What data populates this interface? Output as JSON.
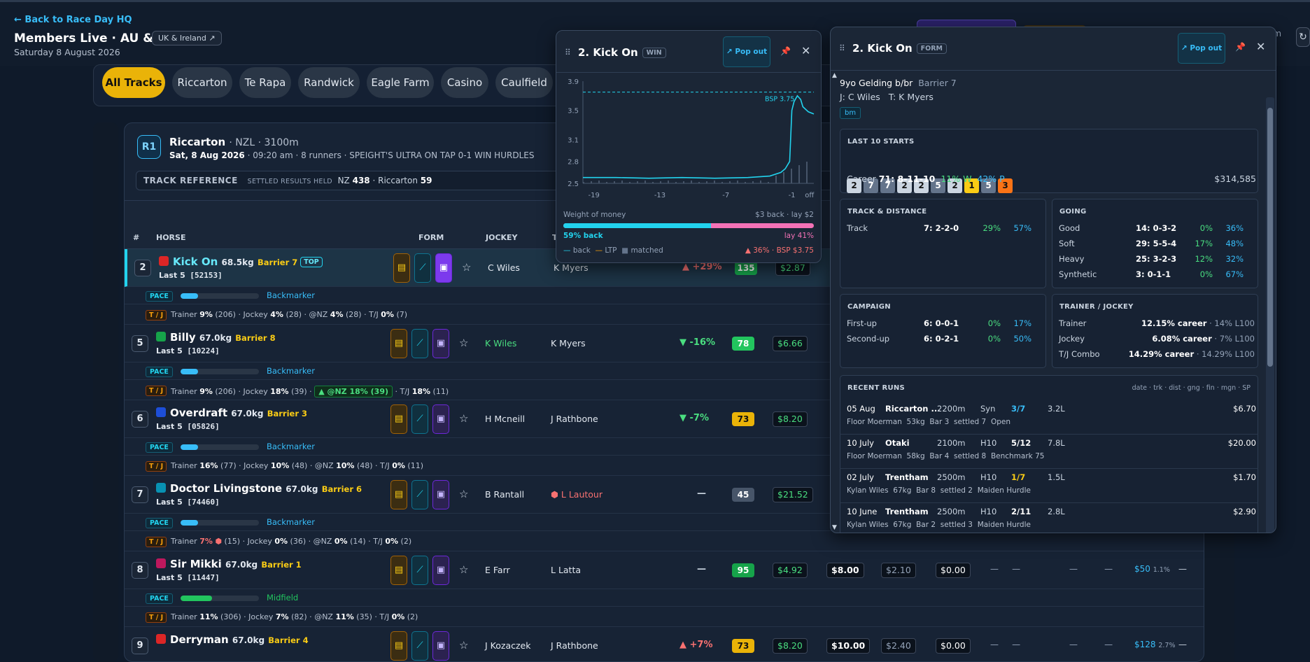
{
  "header": {
    "back": "← Back to Race Day HQ",
    "title": "Members Live · AU & NZ",
    "region": "UK & Ireland ↗",
    "date": "Saturday 8 August 2026",
    "right_text": "am",
    "right_icon": "refresh-icon"
  },
  "tracks": [
    "All Tracks",
    "Riccarton",
    "Te Rapa",
    "Randwick",
    "Eagle Farm",
    "Casino",
    "Caulfield"
  ],
  "race": {
    "badge": "R1",
    "track": "Riccarton",
    "meta": "· NZL · 3100m",
    "date": "Sat, 8 Aug 2026",
    "details": "· 09:20 am · 8 runners · SPEIGHT'S ULTRA ON TAP 0-1 WIN HURDLES",
    "ref_label": "TRACK REFERENCE",
    "ref_sub": "SETTLED RESULTS HELD",
    "ref_nz": "NZ",
    "ref_nz_val": "438",
    "ref_track": "· Riccarton",
    "ref_track_val": "59"
  },
  "columns": {
    "num": "#",
    "horse": "HORSE",
    "form": "FORM",
    "jockey": "JOCKEY",
    "trainer": "T"
  },
  "runners": [
    {
      "num": "2",
      "name": "Kick On",
      "weight": "68.5kg",
      "barrier": "Barrier 7",
      "top": "TOP",
      "last5": "Last 5",
      "form": "[52153]",
      "jockey": "C Wiles",
      "trainer": "K Myers",
      "move": "▲ +29%",
      "rating": "135",
      "odds": "$2.87",
      "pace": "Backmarker",
      "pace_pct": 0.22,
      "tj_trainer": "9%",
      "tj_tn": "(206)",
      "tj_jockey": "4%",
      "tj_jn": "(28)",
      "tj_nz": "4%",
      "tj_nzn": "(28)",
      "tj_combo": "0%",
      "tj_cn": "(7)",
      "silk": "#dc2626"
    },
    {
      "num": "5",
      "name": "Billy",
      "weight": "67.0kg",
      "barrier": "Barrier 8",
      "last5": "Last 5",
      "form": "[10224]",
      "jockey": "K Wiles",
      "trainer": "K Myers",
      "move": "▼ -16%",
      "rating": "78",
      "odds": "$6.66",
      "pace": "Backmarker",
      "pace_pct": 0.22,
      "tj_trainer": "9%",
      "tj_tn": "(206)",
      "tj_jockey": "18%",
      "tj_jn": "(39)",
      "tj_nzbadge": "▲ @NZ 18% (39)",
      "tj_combo": "18%",
      "tj_cn": "(11)",
      "silk": "#16a34a"
    },
    {
      "num": "6",
      "name": "Overdraft",
      "weight": "67.0kg",
      "barrier": "Barrier 3",
      "last5": "Last 5",
      "form": "[05826]",
      "jockey": "H Mcneill",
      "trainer": "J Rathbone",
      "move": "▼ -7%",
      "rating": "73",
      "odds": "$8.20",
      "pace": "Backmarker",
      "pace_pct": 0.22,
      "tj_trainer": "16%",
      "tj_tn": "(77)",
      "tj_jockey": "10%",
      "tj_jn": "(48)",
      "tj_nz": "10%",
      "tj_nzn": "(48)",
      "tj_combo": "0%",
      "tj_cn": "(11)",
      "silk": "#1d4ed8"
    },
    {
      "num": "7",
      "name": "Doctor Livingstone",
      "weight": "67.0kg",
      "barrier": "Barrier 6",
      "last5": "Last 5",
      "form": "[74460]",
      "jockey": "B Rantall",
      "trainer": "L Lautour",
      "move": "—",
      "rating": "45",
      "odds": "$21.52",
      "pace": "Backmarker",
      "pace_pct": 0.22,
      "tj_trainer": "7%",
      "tj_tn": "(15)",
      "tj_jockey": "0%",
      "tj_jn": "(36)",
      "tj_nz": "0%",
      "tj_nzn": "(14)",
      "tj_combo": "0%",
      "tj_cn": "(2)",
      "silk": "#0891b2"
    },
    {
      "num": "8",
      "name": "Sir Mikki",
      "weight": "67.0kg",
      "barrier": "Barrier 1",
      "last5": "Last 5",
      "form": "[11447]",
      "jockey": "E Farr",
      "trainer": "L Latta",
      "move": "—",
      "rating": "95",
      "odds": "$4.92",
      "odds2": "$8.00",
      "odds3": "$2.10",
      "odds4": "$0.00",
      "extra": "$50",
      "extra_pct": "1.1%",
      "pace": "Midfield",
      "pace_pct": 0.4,
      "tj_trainer": "11%",
      "tj_tn": "(306)",
      "tj_jockey": "7%",
      "tj_jn": "(82)",
      "tj_nz": "11%",
      "tj_nzn": "(35)",
      "tj_combo": "0%",
      "tj_cn": "(2)",
      "silk": "#be185d"
    },
    {
      "num": "9",
      "name": "Derryman",
      "weight": "67.0kg",
      "barrier": "Barrier 4",
      "last5": "Last 5",
      "jockey": "J Kozaczek",
      "trainer": "J Rathbone",
      "move": "▲ +7%",
      "rating": "73",
      "odds": "$8.20",
      "odds2": "$10.00",
      "odds3": "$2.40",
      "odds4": "$0.00",
      "extra": "$128",
      "extra_pct": "2.7%",
      "silk": "#dc2626"
    }
  ],
  "labels": {
    "pace": "PACE",
    "tj": "T / J",
    "trainer": "Trainer",
    "jockey": "Jockey",
    "nz": "@NZ",
    "combo": "T/J"
  },
  "chart_popup": {
    "title": "2. Kick On",
    "tag": "WIN",
    "popout": "Pop out",
    "pin_icon": "pin-icon",
    "close_icon": "close-icon",
    "wom_label": "Weight of money",
    "wom_odds": "$3 back · lay $2",
    "wom_back": "59% back",
    "wom_lay": "lay 41%",
    "back_pct": 0.59,
    "legend": [
      "back",
      "LTP",
      "matched"
    ],
    "bsp_note": "▲ 36% · BSP $3.75",
    "bsp_line": "BSP 3.75"
  },
  "chart_data": {
    "type": "line",
    "title": "",
    "x_ticks": [
      "-19",
      "-13",
      "-7",
      "-1",
      "off"
    ],
    "y_ticks": [
      "2.5",
      "2.8",
      "3.1",
      "3.5",
      "3.9"
    ],
    "ylim": [
      2.5,
      3.9
    ],
    "bsp": 3.75,
    "series": [
      {
        "name": "LTP",
        "x": [
          -20,
          -17,
          -14,
          -11,
          -8,
          -5,
          -3,
          -2,
          -1.6,
          -1.2,
          -1,
          -0.8,
          -0.5,
          -0.2,
          0,
          0.5,
          1
        ],
        "y": [
          2.58,
          2.58,
          2.57,
          2.58,
          2.57,
          2.58,
          2.6,
          2.65,
          2.7,
          2.8,
          3.5,
          3.62,
          3.7,
          3.65,
          3.55,
          3.48,
          3.45
        ]
      }
    ]
  },
  "form_popup": {
    "title": "2. Kick On",
    "tag": "FORM",
    "popout": "Pop out",
    "desc": "9yo Gelding b/br",
    "barrier": "Barrier 7",
    "jt": "J: C Wiles   T: K Myers",
    "bm": "bm",
    "last10_label": "LAST 10 STARTS",
    "last10": [
      "2",
      "7",
      "7",
      "2",
      "2",
      "5",
      "2",
      "1",
      "5",
      "3"
    ],
    "career_label": "Career",
    "career": "71: 8-11-10",
    "win_pct": "11% W",
    "place_pct": "42% P",
    "prize": "$314,585",
    "td_label": "TRACK & DISTANCE",
    "td": [
      {
        "k": "Track",
        "r": "7: 2-2-0",
        "w": "29%",
        "p": "57%"
      }
    ],
    "going_label": "GOING",
    "going": [
      {
        "k": "Good",
        "r": "14: 0-3-2",
        "w": "0%",
        "p": "36%"
      },
      {
        "k": "Soft",
        "r": "29: 5-5-4",
        "w": "17%",
        "p": "48%"
      },
      {
        "k": "Heavy",
        "r": "25: 3-2-3",
        "w": "12%",
        "p": "32%"
      },
      {
        "k": "Synthetic",
        "r": "3: 0-1-1",
        "w": "0%",
        "p": "67%"
      }
    ],
    "camp_label": "CAMPAIGN",
    "camp": [
      {
        "k": "First-up",
        "r": "6: 0-0-1",
        "w": "0%",
        "p": "17%"
      },
      {
        "k": "Second-up",
        "r": "6: 0-2-1",
        "w": "0%",
        "p": "50%"
      }
    ],
    "tj_label": "TRAINER / JOCKEY",
    "tj": [
      {
        "k": "Trainer",
        "v": "12.15% career",
        "l": "· 14% L100"
      },
      {
        "k": "Jockey",
        "v": "6.08% career",
        "l": "· 7% L100"
      },
      {
        "k": "T/J Combo",
        "v": "14.29% career",
        "l": "· 14.29% L100"
      }
    ],
    "recent_label": "RECENT RUNS",
    "recent_cols": "date · trk · dist · gng · fin · mgn · SP",
    "recent": [
      {
        "date": "05 Aug",
        "trk": "Riccarton ...",
        "dist": "2200m",
        "gng": "Syn",
        "fin": "3/7",
        "mgn": "3.2L",
        "sp": "$6.70",
        "jock": "Floor Moerman",
        "wt": "53kg",
        "bar": "Bar 3",
        "set": "settled 7",
        "cls": "Open"
      },
      {
        "date": "10 July",
        "trk": "Otaki",
        "dist": "2100m",
        "gng": "H10",
        "fin": "5/12",
        "mgn": "7.8L",
        "sp": "$20.00",
        "jock": "Floor Moerman",
        "wt": "58kg",
        "bar": "Bar 4",
        "set": "settled 8",
        "cls": "Benchmark 75"
      },
      {
        "date": "02 July",
        "trk": "Trentham",
        "dist": "2500m",
        "gng": "H10",
        "fin": "1/7",
        "mgn": "1.5L",
        "sp": "$1.70",
        "jock": "Kylan Wiles",
        "wt": "67kg",
        "bar": "Bar 8",
        "set": "settled 2",
        "cls": "Maiden Hurdle"
      },
      {
        "date": "10 June",
        "trk": "Trentham",
        "dist": "2500m",
        "gng": "H10",
        "fin": "2/11",
        "mgn": "2.8L",
        "sp": "$2.90",
        "jock": "Kylan Wiles",
        "wt": "67kg",
        "bar": "Bar 2",
        "set": "settled 3",
        "cls": "Maiden Hurdle"
      }
    ]
  }
}
